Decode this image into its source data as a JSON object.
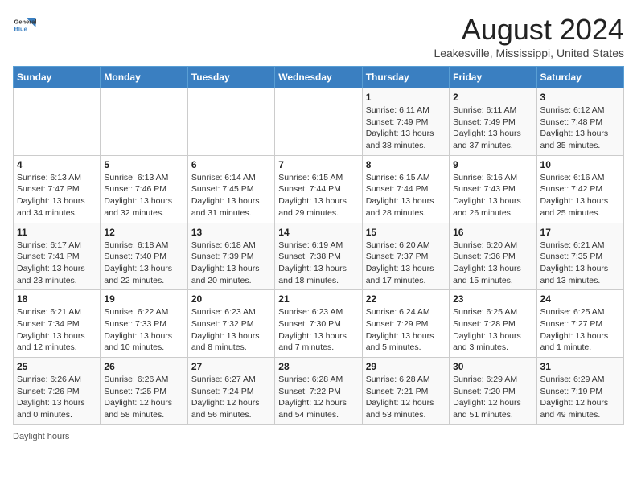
{
  "logo": {
    "general": "General",
    "blue": "Blue"
  },
  "header": {
    "month_year": "August 2024",
    "location": "Leakesville, Mississippi, United States"
  },
  "days_of_week": [
    "Sunday",
    "Monday",
    "Tuesday",
    "Wednesday",
    "Thursday",
    "Friday",
    "Saturday"
  ],
  "weeks": [
    [
      {
        "day": "",
        "info": ""
      },
      {
        "day": "",
        "info": ""
      },
      {
        "day": "",
        "info": ""
      },
      {
        "day": "",
        "info": ""
      },
      {
        "day": "1",
        "info": "Sunrise: 6:11 AM\nSunset: 7:49 PM\nDaylight: 13 hours and 38 minutes."
      },
      {
        "day": "2",
        "info": "Sunrise: 6:11 AM\nSunset: 7:49 PM\nDaylight: 13 hours and 37 minutes."
      },
      {
        "day": "3",
        "info": "Sunrise: 6:12 AM\nSunset: 7:48 PM\nDaylight: 13 hours and 35 minutes."
      }
    ],
    [
      {
        "day": "4",
        "info": "Sunrise: 6:13 AM\nSunset: 7:47 PM\nDaylight: 13 hours and 34 minutes."
      },
      {
        "day": "5",
        "info": "Sunrise: 6:13 AM\nSunset: 7:46 PM\nDaylight: 13 hours and 32 minutes."
      },
      {
        "day": "6",
        "info": "Sunrise: 6:14 AM\nSunset: 7:45 PM\nDaylight: 13 hours and 31 minutes."
      },
      {
        "day": "7",
        "info": "Sunrise: 6:15 AM\nSunset: 7:44 PM\nDaylight: 13 hours and 29 minutes."
      },
      {
        "day": "8",
        "info": "Sunrise: 6:15 AM\nSunset: 7:44 PM\nDaylight: 13 hours and 28 minutes."
      },
      {
        "day": "9",
        "info": "Sunrise: 6:16 AM\nSunset: 7:43 PM\nDaylight: 13 hours and 26 minutes."
      },
      {
        "day": "10",
        "info": "Sunrise: 6:16 AM\nSunset: 7:42 PM\nDaylight: 13 hours and 25 minutes."
      }
    ],
    [
      {
        "day": "11",
        "info": "Sunrise: 6:17 AM\nSunset: 7:41 PM\nDaylight: 13 hours and 23 minutes."
      },
      {
        "day": "12",
        "info": "Sunrise: 6:18 AM\nSunset: 7:40 PM\nDaylight: 13 hours and 22 minutes."
      },
      {
        "day": "13",
        "info": "Sunrise: 6:18 AM\nSunset: 7:39 PM\nDaylight: 13 hours and 20 minutes."
      },
      {
        "day": "14",
        "info": "Sunrise: 6:19 AM\nSunset: 7:38 PM\nDaylight: 13 hours and 18 minutes."
      },
      {
        "day": "15",
        "info": "Sunrise: 6:20 AM\nSunset: 7:37 PM\nDaylight: 13 hours and 17 minutes."
      },
      {
        "day": "16",
        "info": "Sunrise: 6:20 AM\nSunset: 7:36 PM\nDaylight: 13 hours and 15 minutes."
      },
      {
        "day": "17",
        "info": "Sunrise: 6:21 AM\nSunset: 7:35 PM\nDaylight: 13 hours and 13 minutes."
      }
    ],
    [
      {
        "day": "18",
        "info": "Sunrise: 6:21 AM\nSunset: 7:34 PM\nDaylight: 13 hours and 12 minutes."
      },
      {
        "day": "19",
        "info": "Sunrise: 6:22 AM\nSunset: 7:33 PM\nDaylight: 13 hours and 10 minutes."
      },
      {
        "day": "20",
        "info": "Sunrise: 6:23 AM\nSunset: 7:32 PM\nDaylight: 13 hours and 8 minutes."
      },
      {
        "day": "21",
        "info": "Sunrise: 6:23 AM\nSunset: 7:30 PM\nDaylight: 13 hours and 7 minutes."
      },
      {
        "day": "22",
        "info": "Sunrise: 6:24 AM\nSunset: 7:29 PM\nDaylight: 13 hours and 5 minutes."
      },
      {
        "day": "23",
        "info": "Sunrise: 6:25 AM\nSunset: 7:28 PM\nDaylight: 13 hours and 3 minutes."
      },
      {
        "day": "24",
        "info": "Sunrise: 6:25 AM\nSunset: 7:27 PM\nDaylight: 13 hours and 1 minute."
      }
    ],
    [
      {
        "day": "25",
        "info": "Sunrise: 6:26 AM\nSunset: 7:26 PM\nDaylight: 13 hours and 0 minutes."
      },
      {
        "day": "26",
        "info": "Sunrise: 6:26 AM\nSunset: 7:25 PM\nDaylight: 12 hours and 58 minutes."
      },
      {
        "day": "27",
        "info": "Sunrise: 6:27 AM\nSunset: 7:24 PM\nDaylight: 12 hours and 56 minutes."
      },
      {
        "day": "28",
        "info": "Sunrise: 6:28 AM\nSunset: 7:22 PM\nDaylight: 12 hours and 54 minutes."
      },
      {
        "day": "29",
        "info": "Sunrise: 6:28 AM\nSunset: 7:21 PM\nDaylight: 12 hours and 53 minutes."
      },
      {
        "day": "30",
        "info": "Sunrise: 6:29 AM\nSunset: 7:20 PM\nDaylight: 12 hours and 51 minutes."
      },
      {
        "day": "31",
        "info": "Sunrise: 6:29 AM\nSunset: 7:19 PM\nDaylight: 12 hours and 49 minutes."
      }
    ]
  ],
  "footer": {
    "note": "Daylight hours"
  }
}
